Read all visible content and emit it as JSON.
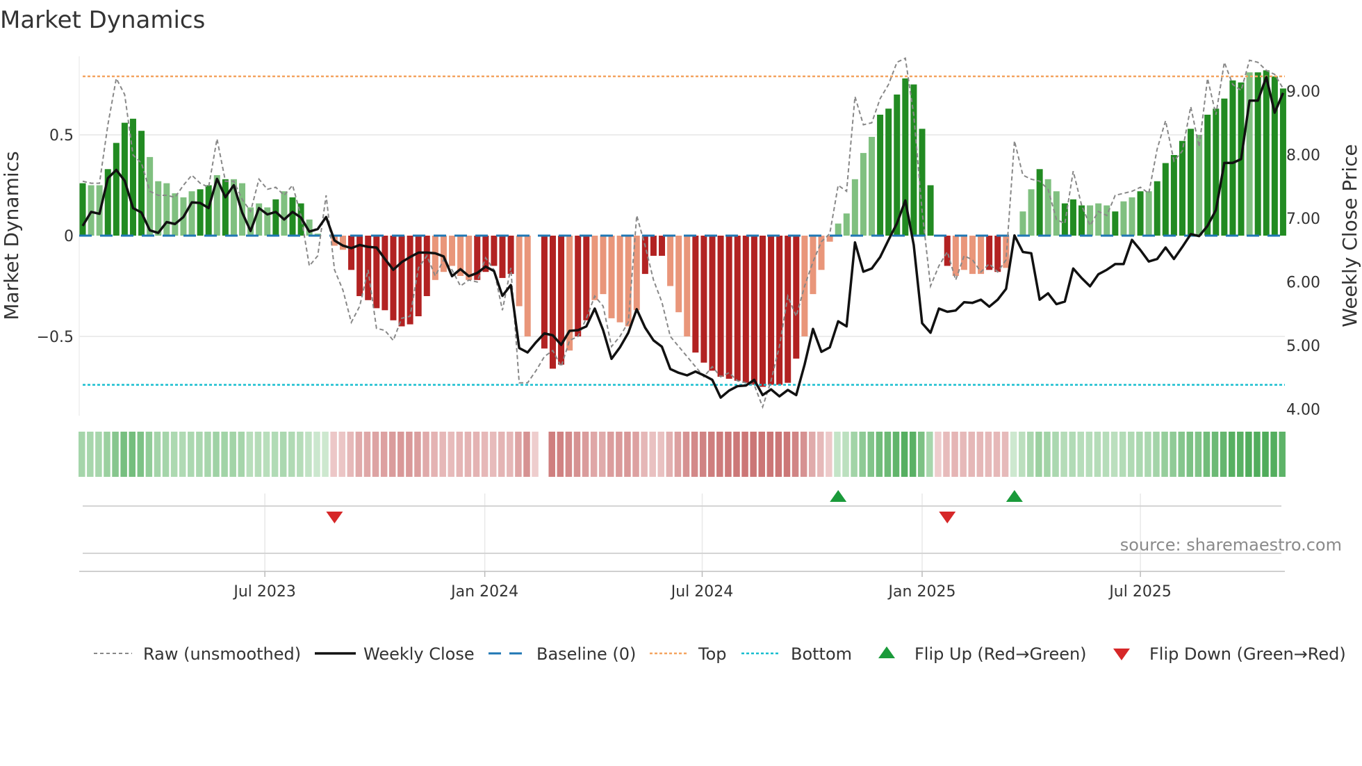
{
  "title": "Market Dynamics",
  "source": "source: sharemaestro.com",
  "chart_data": {
    "type": "bar",
    "title": "Market Dynamics",
    "ylabel": "Market Dynamics",
    "y2label": "Weekly Close Price",
    "ylim": [
      -0.92,
      0.98
    ],
    "y2lim": [
      3.85,
      10.1
    ],
    "yticks": [
      {
        "v": 0.5,
        "label": "0.5"
      },
      {
        "v": 0,
        "label": "0"
      },
      {
        "v": -0.5,
        "label": "−0.5"
      }
    ],
    "y2ticks": [
      {
        "v": 9,
        "label": "9.00"
      },
      {
        "v": 8,
        "label": "8.00"
      },
      {
        "v": 7,
        "label": "7.00"
      },
      {
        "v": 6,
        "label": "6.00"
      },
      {
        "v": 5,
        "label": "5.00"
      },
      {
        "v": 4,
        "label": "4.00"
      }
    ],
    "xticks": [
      {
        "i": 21.7,
        "label": "Jul 2023"
      },
      {
        "i": 47.9,
        "label": "Jan 2024"
      },
      {
        "i": 73.8,
        "label": "Jul 2024"
      },
      {
        "i": 100.0,
        "label": "Jan 2025"
      },
      {
        "i": 126.0,
        "label": "Jul 2025"
      }
    ],
    "top_level": 0.79,
    "bottom_level": -0.74,
    "baseline": 0,
    "colors": {
      "green_strong": "#228b22",
      "green_weak": "#80c080",
      "red_strong": "#b22222",
      "red_weak": "#e9967a",
      "raw": "#888888",
      "close": "#111111",
      "baseline": "#1f77b4",
      "top": "#f4a460",
      "bottom": "#17becf",
      "flip_up": "#1a9a3a",
      "flip_down": "#d62728"
    },
    "momentum": [
      30,
      24,
      1,
      35,
      12,
      1,
      8,
      1,
      32
    ],
    "values": [
      0.26,
      0.25,
      0.25,
      0.33,
      0.46,
      0.56,
      0.58,
      0.52,
      0.39,
      0.27,
      0.26,
      0.21,
      0.19,
      0.22,
      0.23,
      0.25,
      0.3,
      0.28,
      0.28,
      0.26,
      0.14,
      0.16,
      0.14,
      0.18,
      0.22,
      0.19,
      0.16,
      0.08,
      0.01,
      0,
      -0.05,
      -0.07,
      -0.17,
      -0.3,
      -0.32,
      -0.36,
      -0.37,
      -0.42,
      -0.45,
      -0.44,
      -0.4,
      -0.3,
      -0.22,
      -0.18,
      -0.15,
      -0.2,
      -0.22,
      -0.22,
      -0.18,
      -0.15,
      -0.21,
      -0.19,
      -0.35,
      -0.5,
      0,
      -0.56,
      -0.66,
      -0.64,
      -0.57,
      -0.5,
      -0.42,
      -0.32,
      -0.29,
      -0.41,
      -0.43,
      -0.45,
      -0.37,
      -0.19,
      -0.1,
      -0.1,
      -0.25,
      -0.38,
      -0.5,
      -0.58,
      -0.63,
      -0.67,
      -0.7,
      -0.71,
      -0.72,
      -0.73,
      -0.74,
      -0.75,
      -0.74,
      -0.74,
      -0.73,
      -0.61,
      -0.5,
      -0.29,
      -0.17,
      -0.03,
      0.06,
      0.11,
      0.28,
      0.41,
      0.49,
      0.6,
      0.63,
      0.7,
      0.78,
      0.75,
      0.53,
      0.25,
      0,
      -0.15,
      -0.2,
      -0.17,
      -0.19,
      -0.19,
      -0.17,
      -0.18,
      -0.16,
      0,
      0.12,
      0.23,
      0.33,
      0.28,
      0.22,
      0.16,
      0.18,
      0.15,
      0.15,
      0.16,
      0.15,
      0.12,
      0.17,
      0.19,
      0.22,
      0.22,
      0.27,
      0.36,
      0.4,
      0.47,
      0.53,
      0.5,
      0.6,
      0.63,
      0.68,
      0.77,
      0.76,
      0.81,
      0.81,
      0.82,
      0.79,
      0.73
    ],
    "strength": "dlldddddllllllddldllllldlddlllll ddddddddddllllldddddllddddl ddlllllldddllldddddddddddddlllllllll dddddddddlll l ddldlldl l dddllldlldldddddldddddlddddlddddll",
    "raw": [
      0.27,
      0.26,
      0.26,
      0.55,
      0.78,
      0.7,
      0.4,
      0.36,
      0.22,
      0.2,
      0.2,
      0.19,
      0.25,
      0.3,
      0.26,
      0.24,
      0.48,
      0.27,
      0.27,
      0.18,
      0.12,
      0.28,
      0.23,
      0.24,
      0.2,
      0.25,
      0.1,
      -0.15,
      -0.1,
      0.2,
      -0.17,
      -0.27,
      -0.43,
      -0.35,
      -0.17,
      -0.46,
      -0.47,
      -0.52,
      -0.41,
      -0.4,
      -0.16,
      -0.1,
      -0.2,
      -0.12,
      -0.17,
      -0.25,
      -0.22,
      -0.23,
      -0.11,
      -0.17,
      -0.37,
      -0.16,
      -0.73,
      -0.73,
      -0.67,
      -0.6,
      -0.57,
      -0.65,
      -0.52,
      -0.5,
      -0.41,
      -0.3,
      -0.35,
      -0.55,
      -0.5,
      -0.43,
      0.1,
      -0.05,
      -0.22,
      -0.33,
      -0.5,
      -0.55,
      -0.6,
      -0.65,
      -0.7,
      -0.65,
      -0.7,
      -0.68,
      -0.72,
      -0.73,
      -0.74,
      -0.85,
      -0.72,
      -0.55,
      -0.3,
      -0.4,
      -0.25,
      -0.13,
      -0.03,
      0.01,
      0.25,
      0.22,
      0.69,
      0.55,
      0.56,
      0.68,
      0.75,
      0.86,
      0.88,
      0.6,
      0.12,
      -0.25,
      -0.15,
      -0.08,
      -0.22,
      -0.1,
      -0.12,
      -0.18,
      -0.14,
      -0.18,
      -0.12,
      0.47,
      0.3,
      0.28,
      0.27,
      0.23,
      0.08,
      0.06,
      0.32,
      0.15,
      0.05,
      0.12,
      0.1,
      0.2,
      0.21,
      0.22,
      0.24,
      0.21,
      0.43,
      0.57,
      0.37,
      0.42,
      0.64,
      0.44,
      0.78,
      0.6,
      0.86,
      0.75,
      0.72,
      0.87,
      0.86,
      0.82,
      0.8,
      0.73
    ],
    "close": [
      6.88,
      7.1,
      7.07,
      7.63,
      7.76,
      7.59,
      7.16,
      7.09,
      6.81,
      6.77,
      6.94,
      6.91,
      7.02,
      7.25,
      7.24,
      7.16,
      7.62,
      7.33,
      7.52,
      7.09,
      6.8,
      7.16,
      7.06,
      7.1,
      6.98,
      7.1,
      7.01,
      6.79,
      6.83,
      7.02,
      6.65,
      6.57,
      6.53,
      6.58,
      6.55,
      6.54,
      6.36,
      6.19,
      6.31,
      6.39,
      6.46,
      6.46,
      6.45,
      6.4,
      6.09,
      6.2,
      6.09,
      6.14,
      6.24,
      6.17,
      5.78,
      5.95,
      4.96,
      4.89,
      5.05,
      5.19,
      5.16,
      5.01,
      5.23,
      5.24,
      5.3,
      5.58,
      5.24,
      4.79,
      4.97,
      5.2,
      5.57,
      5.28,
      5.08,
      4.98,
      4.63,
      4.57,
      4.53,
      4.59,
      4.53,
      4.46,
      4.18,
      4.29,
      4.36,
      4.37,
      4.46,
      4.22,
      4.31,
      4.2,
      4.3,
      4.22,
      4.7,
      5.26,
      4.9,
      4.97,
      5.38,
      5.3,
      6.62,
      6.16,
      6.21,
      6.39,
      6.66,
      6.92,
      7.28,
      6.58,
      5.35,
      5.2,
      5.58,
      5.53,
      5.55,
      5.68,
      5.67,
      5.72,
      5.61,
      5.72,
      5.89,
      6.73,
      6.47,
      6.45,
      5.72,
      5.82,
      5.65,
      5.69,
      6.21,
      6.06,
      5.93,
      6.12,
      6.19,
      6.28,
      6.28,
      6.66,
      6.5,
      6.32,
      6.36,
      6.54,
      6.36,
      6.55,
      6.75,
      6.72,
      6.88,
      7.13,
      7.87,
      7.87,
      7.93,
      8.85,
      8.85,
      9.22,
      8.66,
      8.97
    ],
    "strip_gaps": [
      55
    ],
    "flips": [
      {
        "i": 30,
        "dir": "down"
      },
      {
        "i": 90,
        "dir": "up"
      },
      {
        "i": 103,
        "dir": "down"
      },
      {
        "i": 111,
        "dir": "up"
      }
    ],
    "legend": {
      "placement": "bottom",
      "raw": "Raw (unsmoothed)",
      "close": "Weekly Close",
      "baseline": "Baseline (0)",
      "top": "Top",
      "bottom": "Bottom",
      "flip_up": "Flip Up (Red→Green)",
      "flip_down": "Flip Down (Green→Red)"
    }
  }
}
